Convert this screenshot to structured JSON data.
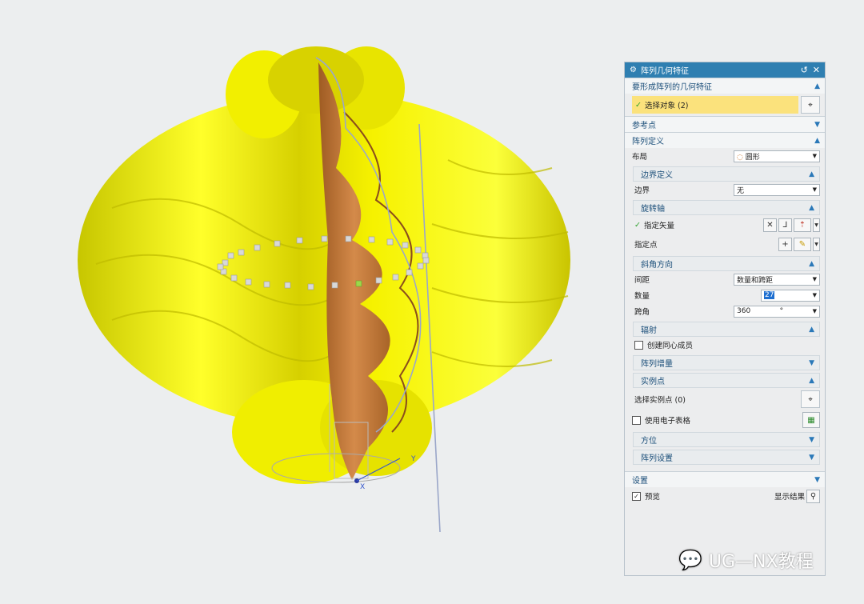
{
  "dialog": {
    "title": "阵列几何特征",
    "sections": {
      "geometry_to_pattern": "要形成阵列的几何特征",
      "select_object": "选择对象 (2)",
      "reference_point": "参考点",
      "pattern_definition": "阵列定义",
      "settings": "设置"
    },
    "layout": {
      "label": "布局",
      "value": "圆形"
    },
    "boundary": {
      "header": "边界定义",
      "label": "边界",
      "value": "无"
    },
    "rotation_axis": {
      "header": "旋转轴",
      "specify_vector": "指定矢量",
      "specify_point": "指定点"
    },
    "angular_direction": {
      "header": "斜角方向",
      "spacing_label": "间距",
      "spacing_value": "数量和跨距",
      "count_label": "数量",
      "count_value": "27",
      "span_label": "跨角",
      "span_value": "360",
      "span_unit": "°"
    },
    "radiate": {
      "header": "辐射",
      "create_concentric": "创建同心成员"
    },
    "pattern_increment": "阵列增量",
    "instance_points": {
      "header": "实例点",
      "select_label": "选择实例点 (0)"
    },
    "use_spreadsheet": "使用电子表格",
    "orientation": "方位",
    "pattern_settings": "阵列设置",
    "preview_label": "预览",
    "show_result_label": "显示结果"
  },
  "viewport": {
    "axis_x": "X",
    "axis_y": "Y",
    "colors": {
      "surface_yellow": "#f4f200",
      "surface_inner": "#c87a38",
      "selected_point": "#9bd84a"
    }
  },
  "watermark": {
    "text": "UG—NX教程"
  }
}
